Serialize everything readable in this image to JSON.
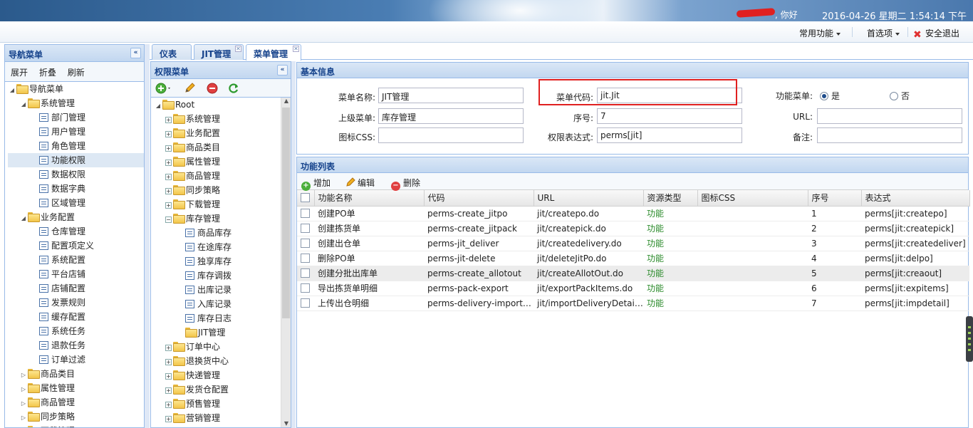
{
  "header": {
    "greeting": ", 你好",
    "datetime": "2016-04-26 星期二 1:54:14 下午"
  },
  "toolbar": {
    "common_label": "常用功能",
    "prefs_label": "首选项",
    "logout_label": "安全退出"
  },
  "nav": {
    "title": "导航菜单",
    "collapse": "«",
    "actions": [
      "展开",
      "折叠",
      "刷新"
    ],
    "tree": [
      {
        "label": "导航菜单",
        "type": "folder",
        "level": 0,
        "expanded": true
      },
      {
        "label": "系统管理",
        "type": "folder",
        "level": 1,
        "expanded": true
      },
      {
        "label": "部门管理",
        "type": "leaf",
        "level": 2
      },
      {
        "label": "用户管理",
        "type": "leaf",
        "level": 2
      },
      {
        "label": "角色管理",
        "type": "leaf",
        "level": 2
      },
      {
        "label": "功能权限",
        "type": "leaf",
        "level": 2,
        "selected": true
      },
      {
        "label": "数据权限",
        "type": "leaf",
        "level": 2
      },
      {
        "label": "数据字典",
        "type": "leaf",
        "level": 2
      },
      {
        "label": "区域管理",
        "type": "leaf",
        "level": 2
      },
      {
        "label": "业务配置",
        "type": "folder",
        "level": 1,
        "expanded": true
      },
      {
        "label": "仓库管理",
        "type": "leaf",
        "level": 2
      },
      {
        "label": "配置项定义",
        "type": "leaf",
        "level": 2
      },
      {
        "label": "系统配置",
        "type": "leaf",
        "level": 2
      },
      {
        "label": "平台店铺",
        "type": "leaf",
        "level": 2
      },
      {
        "label": "店铺配置",
        "type": "leaf",
        "level": 2
      },
      {
        "label": "发票规则",
        "type": "leaf",
        "level": 2
      },
      {
        "label": "缓存配置",
        "type": "leaf",
        "level": 2
      },
      {
        "label": "系统任务",
        "type": "leaf",
        "level": 2
      },
      {
        "label": "退款任务",
        "type": "leaf",
        "level": 2
      },
      {
        "label": "订单过滤",
        "type": "leaf",
        "level": 2
      },
      {
        "label": "商品类目",
        "type": "folder",
        "level": 1,
        "expanded": false
      },
      {
        "label": "属性管理",
        "type": "folder",
        "level": 1,
        "expanded": false
      },
      {
        "label": "商品管理",
        "type": "folder",
        "level": 1,
        "expanded": false
      },
      {
        "label": "同步策略",
        "type": "folder",
        "level": 1,
        "expanded": false
      },
      {
        "label": "下载管理",
        "type": "folder",
        "level": 1,
        "expanded": false
      }
    ]
  },
  "tabs": [
    {
      "label": "仪表盘",
      "closable": false,
      "active": false
    },
    {
      "label": "JIT管理",
      "closable": true,
      "active": false
    },
    {
      "label": "菜单管理",
      "closable": true,
      "active": true
    }
  ],
  "perm": {
    "title": "权限菜单",
    "collapse": "«",
    "tree": [
      {
        "label": "Root",
        "type": "folder",
        "level": 0,
        "expanded": true
      },
      {
        "label": "系统管理",
        "type": "folder",
        "level": 1,
        "expanded": false
      },
      {
        "label": "业务配置",
        "type": "folder",
        "level": 1,
        "expanded": false
      },
      {
        "label": "商品类目",
        "type": "folder",
        "level": 1,
        "expanded": false
      },
      {
        "label": "属性管理",
        "type": "folder",
        "level": 1,
        "expanded": false
      },
      {
        "label": "商品管理",
        "type": "folder",
        "level": 1,
        "expanded": false
      },
      {
        "label": "同步策略",
        "type": "folder",
        "level": 1,
        "expanded": false
      },
      {
        "label": "下载管理",
        "type": "folder",
        "level": 1,
        "expanded": false
      },
      {
        "label": "库存管理",
        "type": "folder",
        "level": 1,
        "expanded": true
      },
      {
        "label": "商品库存",
        "type": "leaf",
        "level": 2
      },
      {
        "label": "在途库存",
        "type": "leaf",
        "level": 2
      },
      {
        "label": "独享库存",
        "type": "leaf",
        "level": 2
      },
      {
        "label": "库存调拨",
        "type": "leaf",
        "level": 2
      },
      {
        "label": "出库记录",
        "type": "leaf",
        "level": 2
      },
      {
        "label": "入库记录",
        "type": "leaf",
        "level": 2
      },
      {
        "label": "库存日志",
        "type": "leaf",
        "level": 2
      },
      {
        "label": "JIT管理",
        "type": "folder-leaf",
        "level": 2
      },
      {
        "label": "订单中心",
        "type": "folder",
        "level": 1,
        "expanded": false
      },
      {
        "label": "退换货中心",
        "type": "folder",
        "level": 1,
        "expanded": false
      },
      {
        "label": "快递管理",
        "type": "folder",
        "level": 1,
        "expanded": false
      },
      {
        "label": "发货仓配置",
        "type": "folder",
        "level": 1,
        "expanded": false
      },
      {
        "label": "预售管理",
        "type": "folder",
        "level": 1,
        "expanded": false
      },
      {
        "label": "营销管理",
        "type": "folder",
        "level": 1,
        "expanded": false
      }
    ]
  },
  "basic": {
    "title": "基本信息",
    "name_label": "菜单名称:",
    "name_value": "JIT管理",
    "code_label": "菜单代码:",
    "code_value": "jit.Jit",
    "func_label": "功能菜单:",
    "yes_label": "是",
    "no_label": "否",
    "parent_label": "上级菜单:",
    "parent_value": "库存管理",
    "seq_label": "序号:",
    "seq_value": "7",
    "url_label": "URL:",
    "url_value": "",
    "css_label": "图标CSS:",
    "css_value": "",
    "expr_label": "权限表达式:",
    "expr_value": "perms[jit]",
    "remark_label": "备注:",
    "remark_value": ""
  },
  "func": {
    "title": "功能列表",
    "add_label": "增加",
    "edit_label": "编辑",
    "delete_label": "删除",
    "columns": [
      "功能名称",
      "代码",
      "URL",
      "资源类型",
      "图标CSS",
      "序号",
      "表达式"
    ],
    "rows": [
      [
        "创建PO单",
        "perms-create_jitpo",
        "jit/createpo.do",
        "功能",
        "",
        "1",
        "perms[jit:createpo]"
      ],
      [
        "创建拣货单",
        "perms-create_jitpack",
        "jit/createpick.do",
        "功能",
        "",
        "2",
        "perms[jit:createpick]"
      ],
      [
        "创建出仓单",
        "perms-jit_deliver",
        "jit/createdelivery.do",
        "功能",
        "",
        "3",
        "perms[jit:createdeliver]"
      ],
      [
        "删除PO单",
        "perms-jit-delete",
        "jit/deleteJitPo.do",
        "功能",
        "",
        "4",
        "perms[jit:delpo]"
      ],
      [
        "创建分批出库单",
        "perms-create_allotout",
        "jit/createAllotOut.do",
        "功能",
        "",
        "5",
        "perms[jit:creaout]"
      ],
      [
        "导出拣货单明细",
        "perms-pack-export",
        "jit/exportPackItems.do",
        "功能",
        "",
        "6",
        "perms[jit:expitems]"
      ],
      [
        "上传出仓明细",
        "perms-delivery-importdet...",
        "jit/importDeliveryDetail.do",
        "功能",
        "",
        "7",
        "perms[jit:impdetail]"
      ]
    ]
  },
  "colors": {
    "header_blue": "#15428b",
    "border": "#99bbe8",
    "highlight_red": "#e02020",
    "resource_green": "#2a8a2a"
  }
}
